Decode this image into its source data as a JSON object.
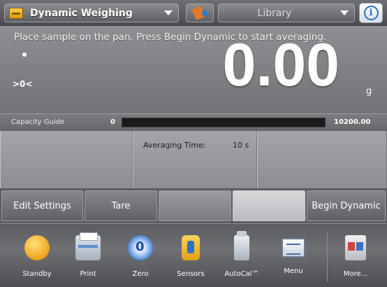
{
  "topbar": {
    "app_icon": "weighing-app-icon",
    "app_title": "Dynamic Weighing",
    "library_label": "Library",
    "info_icon_glyph": "i"
  },
  "display": {
    "instruction": "Place sample on the pan.  Press Begin Dynamic to start averaging.",
    "zero_indicator": ">0<",
    "weight_value": "0.00",
    "unit": "g"
  },
  "capacity_guide": {
    "label": "Capacity Guide",
    "min": "0",
    "max": "10200.00",
    "fill_fraction": 0
  },
  "info_panel": {
    "averaging_label": "Averaging Time:",
    "averaging_value": "10 s"
  },
  "softkeys": {
    "edit_settings": "Edit Settings",
    "tare": "Tare",
    "blank1": "",
    "blank2": "",
    "begin_dynamic": "Begin Dynamic"
  },
  "dock": [
    {
      "label": "Standby",
      "icon": "standby-icon"
    },
    {
      "label": "Print",
      "icon": "printer-icon"
    },
    {
      "label": "Zero",
      "icon": "zero-icon"
    },
    {
      "label": "Sensors",
      "icon": "sensor-icon"
    },
    {
      "label": "AutoCal™",
      "icon": "autocal-icon"
    },
    {
      "label": "Menu",
      "icon": "menu-icon"
    },
    {
      "label": "More...",
      "icon": "more-icon"
    }
  ],
  "colors": {
    "capacity_fill": "#6bbf3a",
    "info_accent": "#2c6fc0",
    "standby_accent": "#f0a21a"
  }
}
